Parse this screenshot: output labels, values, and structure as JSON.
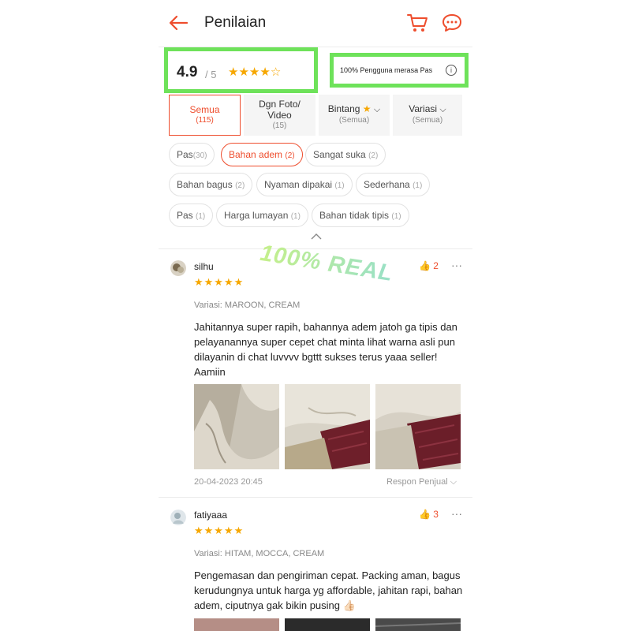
{
  "header": {
    "title": "Penilaian"
  },
  "summary": {
    "rating": "4.9",
    "rating_max": "/ 5",
    "stars_filled": 4,
    "stars_total": 5,
    "fit_text": "100% Pengguna merasa Pas"
  },
  "tabs": [
    {
      "label": "Semua",
      "count": "(115)"
    },
    {
      "label": "Dgn Foto/\nVideo",
      "count": "(15)"
    },
    {
      "label": "Bintang",
      "count": "(Semua)"
    },
    {
      "label": "Variasi",
      "count": "(Semua)"
    }
  ],
  "chips": [
    {
      "label": "Pas",
      "count": "(30)"
    },
    {
      "label": "Bahan adem",
      "count": "(2)"
    },
    {
      "label": "Sangat suka",
      "count": "(2)"
    },
    {
      "label": "Bahan bagus",
      "count": "(2)"
    },
    {
      "label": "Nyaman dipakai",
      "count": "(1)"
    },
    {
      "label": "Sederhana",
      "count": "(1)"
    },
    {
      "label": "Pas",
      "count": "(1)"
    },
    {
      "label": "Harga lumayan",
      "count": "(1)"
    },
    {
      "label": "Bahan tidak tipis",
      "count": "(1)"
    }
  ],
  "watermark": "100% REAL",
  "reviews": [
    {
      "username": "silhu",
      "stars": "★★★★★",
      "likes": "2",
      "variant": "Variasi: MAROON, CREAM",
      "text": "Jahitannya super rapih, bahannya adem jatoh ga tipis dan pelayanannya super cepet chat minta lihat warna asli pun dilayanin di chat luvvvv bgttt sukses terus yaaa seller! Aamiin",
      "date": "20-04-2023 20:45",
      "seller_response": "Respon Penjual"
    },
    {
      "username": "fatiyaaa",
      "stars": "★★★★★",
      "likes": "3",
      "variant": "Variasi: HITAM, MOCCA, CREAM",
      "text": "Pengemasan dan pengiriman cepat. Packing aman, bagus kerudungnya untuk harga yg affordable, jahitan rapi, bahan adem, ciputnya gak bikin pusing 👍🏻"
    }
  ],
  "colors": {
    "accent": "#ee4d2d",
    "star": "#f6a700",
    "highlight": "#6ee25a"
  }
}
